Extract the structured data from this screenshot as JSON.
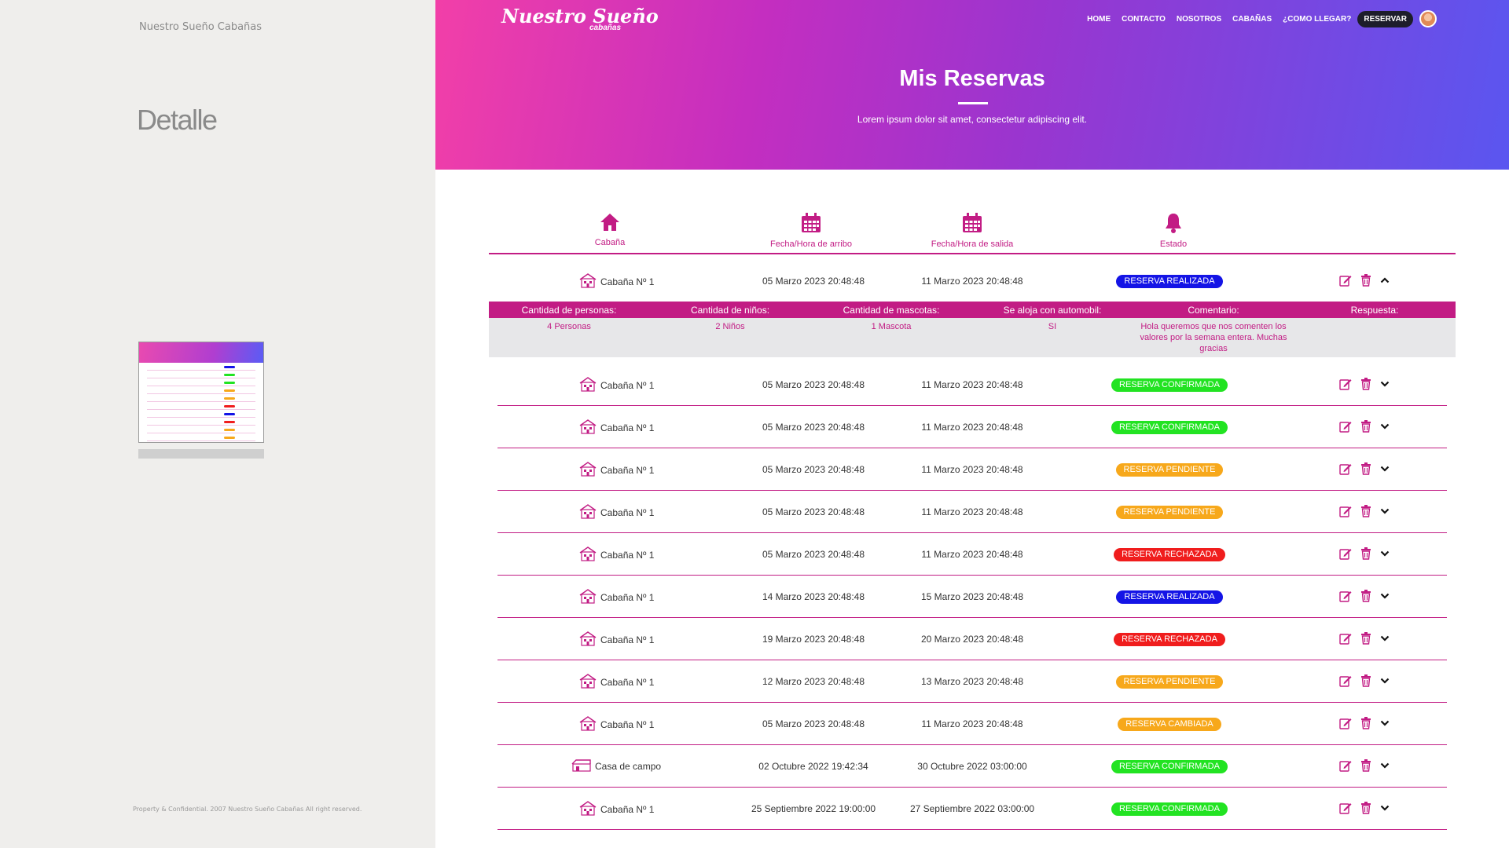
{
  "left": {
    "brand": "Nuestro Sueño Cabañas",
    "title": "Detalle",
    "footer": "Property & Confidential. 2007 Nuestro Sueño Cabañas All right reserved."
  },
  "header": {
    "logo": "Nuestro Sueño",
    "logo_sub": "cabañas",
    "nav": [
      "HOME",
      "CONTACTO",
      "NOSOTROS",
      "CABAÑAS",
      "¿COMO LLEGAR?"
    ],
    "cta": "RESERVAR",
    "title": "Mis Reservas",
    "subtitle": "Lorem ipsum dolor sit amet, consectetur adipiscing elit."
  },
  "columns": {
    "cabin": "Cabaña",
    "arrival": "Fecha/Hora de arribo",
    "departure": "Fecha/Hora de salida",
    "status": "Estado"
  },
  "detail": {
    "headers": [
      "Cantidad de personas:",
      "Cantidad de niños:",
      "Cantidad de mascotas:",
      "Se aloja con automobil:",
      "Comentario:",
      "Respuesta:"
    ],
    "values": [
      "4 Personas",
      "2 Niños",
      "1 Mascota",
      "SI",
      "Hola queremos que nos comenten los valores por la semana entera. Muchas gracias",
      ""
    ]
  },
  "status_colors": {
    "RESERVA REALIZADA": "#1414e6",
    "RESERVA CONFIRMADA": "#22e322",
    "RESERVA PENDIENTE": "#f7a81b",
    "RESERVA RECHAZADA": "#f01d1d",
    "RESERVA CAMBIADA": "#f7a81b"
  },
  "rows": [
    {
      "cabin": "Cabaña Nº 1",
      "arrival": "05 Marzo 2023 20:48:48",
      "departure": "11 Marzo 2023 20:48:48",
      "status": "RESERVA REALIZADA",
      "expanded": true
    },
    {
      "cabin": "Cabaña Nº 1",
      "arrival": "05 Marzo 2023 20:48:48",
      "departure": "11 Marzo 2023 20:48:48",
      "status": "RESERVA CONFIRMADA"
    },
    {
      "cabin": "Cabaña Nº 1",
      "arrival": "05 Marzo 2023 20:48:48",
      "departure": "11 Marzo 2023 20:48:48",
      "status": "RESERVA CONFIRMADA"
    },
    {
      "cabin": "Cabaña Nº 1",
      "arrival": "05 Marzo 2023 20:48:48",
      "departure": "11 Marzo 2023 20:48:48",
      "status": "RESERVA PENDIENTE"
    },
    {
      "cabin": "Cabaña Nº 1",
      "arrival": "05 Marzo 2023 20:48:48",
      "departure": "11 Marzo 2023 20:48:48",
      "status": "RESERVA PENDIENTE"
    },
    {
      "cabin": "Cabaña Nº 1",
      "arrival": "05 Marzo 2023 20:48:48",
      "departure": "11 Marzo 2023 20:48:48",
      "status": "RESERVA RECHAZADA"
    },
    {
      "cabin": "Cabaña Nº 1",
      "arrival": "14 Marzo 2023 20:48:48",
      "departure": "15 Marzo 2023 20:48:48",
      "status": "RESERVA REALIZADA"
    },
    {
      "cabin": "Cabaña Nº 1",
      "arrival": "19 Marzo 2023 20:48:48",
      "departure": "20 Marzo 2023 20:48:48",
      "status": "RESERVA RECHAZADA"
    },
    {
      "cabin": "Cabaña Nº 1",
      "arrival": "12 Marzo 2023 20:48:48",
      "departure": "13 Marzo 2023 20:48:48",
      "status": "RESERVA PENDIENTE"
    },
    {
      "cabin": "Cabaña Nº 1",
      "arrival": "05 Marzo 2023 20:48:48",
      "departure": "11 Marzo 2023 20:48:48",
      "status": "RESERVA CAMBIADA"
    },
    {
      "cabin": "Casa de campo",
      "arrival": "02 Octubre 2022 19:42:34",
      "departure": "30 Octubre 2022 03:00:00",
      "status": "RESERVA CONFIRMADA"
    },
    {
      "cabin": "Cabaña Nº 1",
      "arrival": "25 Septiembre 2022 19:00:00",
      "departure": "27 Septiembre 2022 03:00:00",
      "status": "RESERVA CONFIRMADA"
    }
  ]
}
